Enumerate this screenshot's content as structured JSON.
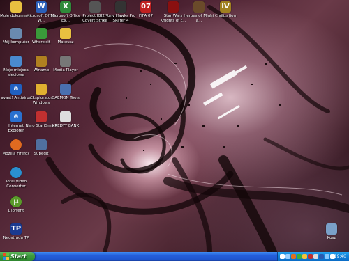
{
  "desktop": {
    "icons": [
      {
        "label": "Moje dokumenty",
        "icon": "folder-documents-icon",
        "color": "#e8c040"
      },
      {
        "label": "Microsoft Office W...",
        "icon": "word-icon",
        "color": "#2b5fb8"
      },
      {
        "label": "Microsoft Office Ex...",
        "icon": "excel-icon",
        "color": "#2f8a3a"
      },
      {
        "label": "Project IGI2 - Covert Strike",
        "icon": "game-icon",
        "color": "#555555"
      },
      {
        "label": "Tony Hawks Pro Skater 4",
        "icon": "game-icon",
        "color": "#333333"
      },
      {
        "label": "FIFA 07",
        "icon": "fifa-icon",
        "color": "#c02020"
      },
      {
        "label": "Star Wars Knights of t...",
        "icon": "game-icon",
        "color": "#8a1010"
      },
      {
        "label": "Heroes of Might a...",
        "icon": "game-icon",
        "color": "#6a4a2a"
      },
      {
        "label": "Civilization",
        "icon": "game-icon",
        "color": "#a08020"
      },
      {
        "label": "Mój komputer",
        "icon": "computer-icon",
        "color": "#6a8ab0"
      },
      {
        "label": "Wherelsit",
        "icon": "app-icon",
        "color": "#3a9a3a"
      },
      {
        "label": "Mateusz",
        "icon": "folder-icon",
        "color": "#e8c040"
      },
      {
        "label": "Moje miejsca sieciowe",
        "icon": "network-icon",
        "color": "#4a8ad0"
      },
      {
        "label": "Winamp",
        "icon": "winamp-icon",
        "color": "#b08020"
      },
      {
        "label": "Media Player",
        "icon": "media-player-icon",
        "color": "#777777"
      },
      {
        "label": "avast! Antivirus",
        "icon": "antivirus-icon",
        "color": "#2060c0"
      },
      {
        "label": "Eksplorator Windows",
        "icon": "explorer-icon",
        "color": "#e0b030"
      },
      {
        "label": "DAEMON Tools",
        "icon": "daemon-tools-icon",
        "color": "#4a70b0"
      },
      {
        "label": "Internet Explorer",
        "icon": "internet-explorer-icon",
        "color": "#2a70d0"
      },
      {
        "label": "Nero StartSmart",
        "icon": "nero-icon",
        "color": "#c03030"
      },
      {
        "label": "KREDYT BANK",
        "icon": "document-icon",
        "color": "#dddddd"
      },
      {
        "label": "Mozilla Firefox",
        "icon": "firefox-icon",
        "color": "#e06a20"
      },
      {
        "label": "Subedit",
        "icon": "app-icon",
        "color": "#5070a0"
      },
      {
        "label": "Total Video Converter",
        "icon": "video-converter-icon",
        "color": "#2a90d0"
      },
      {
        "label": "µTorrent",
        "icon": "utorrent-icon",
        "color": "#5a9a2a"
      },
      {
        "label": "Neostrada TP",
        "icon": "tp-icon",
        "color": "#1a3a90"
      },
      {
        "label": "Kosz",
        "icon": "recycle-bin-icon",
        "color": "#7aa0c8"
      }
    ]
  },
  "taskbar": {
    "start_label": "Start",
    "clock": "19:40",
    "tray_icons": [
      "network-tray-icon",
      "volume-tray-icon",
      "antivirus-tray-icon",
      "messenger-tray-icon",
      "update-tray-icon",
      "tray-icon",
      "tray-icon",
      "tray-icon",
      "tray-icon",
      "tray-icon",
      "tray-icon"
    ]
  }
}
